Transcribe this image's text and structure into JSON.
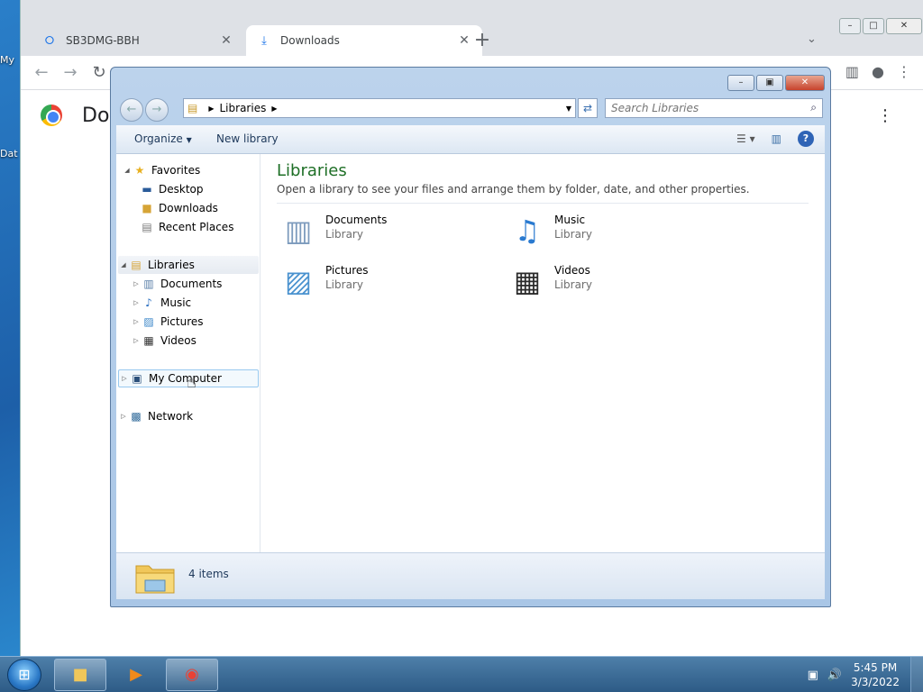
{
  "desktop": {
    "icon1_label": "My",
    "icon2_label": "Dat"
  },
  "chrome": {
    "tabs": [
      {
        "label": "SB3DMG-BBH",
        "favicon": "site-icon"
      },
      {
        "label": "Downloads",
        "favicon": "download-icon"
      }
    ],
    "new_tab": "+",
    "page_title": "Dov"
  },
  "explorer": {
    "address": {
      "crumb": "Libraries"
    },
    "search_placeholder": "Search Libraries",
    "commands": {
      "organize": "Organize",
      "new_library": "New library"
    },
    "nav": {
      "favorites": "Favorites",
      "desktop": "Desktop",
      "downloads": "Downloads",
      "recent": "Recent Places",
      "libraries": "Libraries",
      "documents": "Documents",
      "music": "Music",
      "pictures": "Pictures",
      "videos": "Videos",
      "computer": "My Computer",
      "network": "Network"
    },
    "content": {
      "title": "Libraries",
      "subtitle": "Open a library to see your files and arrange them by folder, date, and other properties.",
      "items": [
        {
          "name": "Documents",
          "type": "Library"
        },
        {
          "name": "Music",
          "type": "Library"
        },
        {
          "name": "Pictures",
          "type": "Library"
        },
        {
          "name": "Videos",
          "type": "Library"
        }
      ]
    },
    "status": "4 items"
  },
  "taskbar": {
    "time": "5:45 PM",
    "date": "3/3/2022"
  }
}
